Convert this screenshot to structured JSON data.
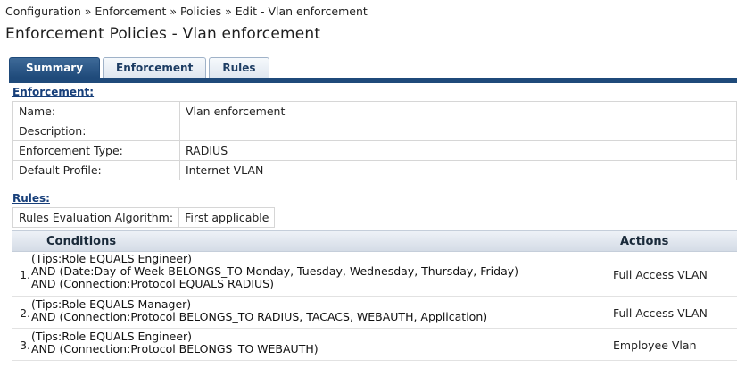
{
  "breadcrumb": "Configuration » Enforcement » Policies » Edit - Vlan enforcement",
  "page_title": "Enforcement Policies - Vlan enforcement",
  "tabs": [
    {
      "label": "Summary"
    },
    {
      "label": "Enforcement"
    },
    {
      "label": "Rules"
    }
  ],
  "enforcement": {
    "heading": "Enforcement:",
    "rows": [
      {
        "label": "Name:",
        "value": "Vlan enforcement"
      },
      {
        "label": "Description:",
        "value": ""
      },
      {
        "label": "Enforcement Type:",
        "value": "RADIUS"
      },
      {
        "label": "Default Profile:",
        "value": "Internet VLAN"
      }
    ]
  },
  "rules": {
    "heading": "Rules:",
    "algorithm_label": "Rules Evaluation Algorithm:",
    "algorithm_value": "First applicable",
    "columns": {
      "conditions": "Conditions",
      "actions": "Actions"
    },
    "items": [
      {
        "number": "1.",
        "conditions": [
          "(Tips:Role EQUALS Engineer)",
          "AND (Date:Day-of-Week BELONGS_TO Monday, Tuesday, Wednesday, Thursday, Friday)",
          "AND (Connection:Protocol EQUALS RADIUS)"
        ],
        "action": "Full Access VLAN"
      },
      {
        "number": "2.",
        "conditions": [
          "(Tips:Role EQUALS Manager)",
          "AND (Connection:Protocol BELONGS_TO RADIUS, TACACS, WEBAUTH, Application)"
        ],
        "action": "Full Access VLAN"
      },
      {
        "number": "3.",
        "conditions": [
          "(Tips:Role EQUALS Engineer)",
          "AND (Connection:Protocol BELONGS_TO WEBAUTH)"
        ],
        "action": "Employee Vlan"
      }
    ]
  }
}
